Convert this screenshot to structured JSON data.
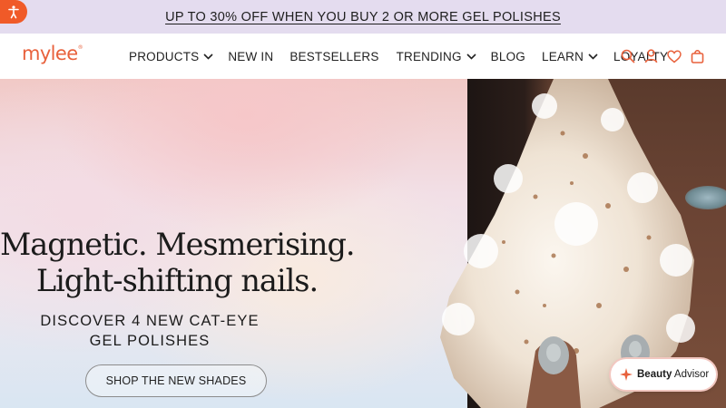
{
  "announcement": {
    "text": "UP TO 30% OFF WHEN YOU BUY 2 OR MORE GEL POLISHES"
  },
  "brand": {
    "logo_text": "mylee",
    "color": "#e8613c"
  },
  "nav": {
    "items": [
      {
        "label": "PRODUCTS",
        "has_dropdown": true
      },
      {
        "label": "NEW IN",
        "has_dropdown": false
      },
      {
        "label": "BESTSELLERS",
        "has_dropdown": false
      },
      {
        "label": "TRENDING",
        "has_dropdown": true
      },
      {
        "label": "BLOG",
        "has_dropdown": false
      },
      {
        "label": "LEARN",
        "has_dropdown": true
      },
      {
        "label": "LOYALTY",
        "has_dropdown": false
      }
    ],
    "icons": [
      "search-icon",
      "account-icon",
      "wishlist-icon",
      "cart-icon"
    ]
  },
  "hero": {
    "headline_line1": "Magnetic. Mesmerising.",
    "headline_line2": "Light-shifting nails.",
    "sub_line1": "DISCOVER 4 NEW CAT-EYE",
    "sub_line2": "GEL POLISHES",
    "cta_label": "SHOP THE NEW SHADES"
  },
  "beauty_advisor": {
    "label_bold": "Beauty",
    "label_rest": " Advisor"
  },
  "colors": {
    "announcement_bg": "#e4dcef",
    "accent": "#e8613c",
    "a11y_button": "#f05a28"
  }
}
